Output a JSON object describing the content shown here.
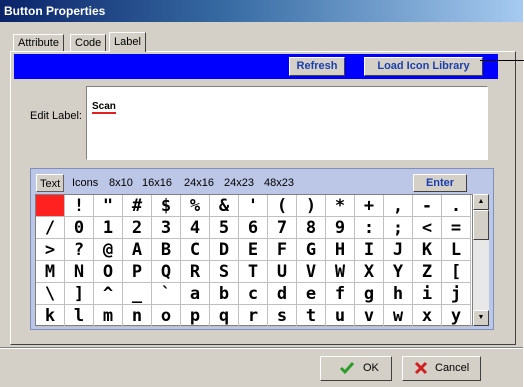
{
  "window": {
    "title": "Button Properties"
  },
  "tabs": [
    "Attribute",
    "Code",
    "Label"
  ],
  "toolbar": {
    "refresh_label": "Refresh",
    "load_icon_label": "Load Icon Library"
  },
  "edit": {
    "label": "Edit Label:",
    "value": "Scan"
  },
  "keyboard": {
    "tabs": [
      "Text",
      "Icons",
      "8x10",
      "16x16",
      "24x16",
      "24x23",
      "48x23"
    ],
    "active_tab": "Text",
    "enter_label": "Enter",
    "rows": [
      [
        " ",
        "!",
        "\"",
        "#",
        "$",
        "%",
        "&",
        "'",
        "(",
        ")",
        "*",
        "+",
        ",",
        "-",
        "."
      ],
      [
        "/",
        "0",
        "1",
        "2",
        "3",
        "4",
        "5",
        "6",
        "7",
        "8",
        "9",
        ":",
        ";",
        "<",
        "="
      ],
      [
        ">",
        "?",
        "@",
        "A",
        "B",
        "C",
        "D",
        "E",
        "F",
        "G",
        "H",
        "I",
        "J",
        "K",
        "L"
      ],
      [
        "M",
        "N",
        "O",
        "P",
        "Q",
        "R",
        "S",
        "T",
        "U",
        "V",
        "W",
        "X",
        "Y",
        "Z",
        "["
      ],
      [
        "\\",
        "]",
        "^",
        "_",
        "`",
        "a",
        "b",
        "c",
        "d",
        "e",
        "f",
        "g",
        "h",
        "i",
        "j"
      ],
      [
        "k",
        "l",
        "m",
        "n",
        "o",
        "p",
        "q",
        "r",
        "s",
        "t",
        "u",
        "v",
        "w",
        "x",
        "y"
      ]
    ]
  },
  "footer": {
    "ok_label": "OK",
    "cancel_label": "Cancel"
  },
  "colors": {
    "accent_bar": "#0000ff",
    "selected_cell": "#ff2020",
    "ok_check": "#2a9d2a",
    "cancel_x": "#d02020"
  }
}
